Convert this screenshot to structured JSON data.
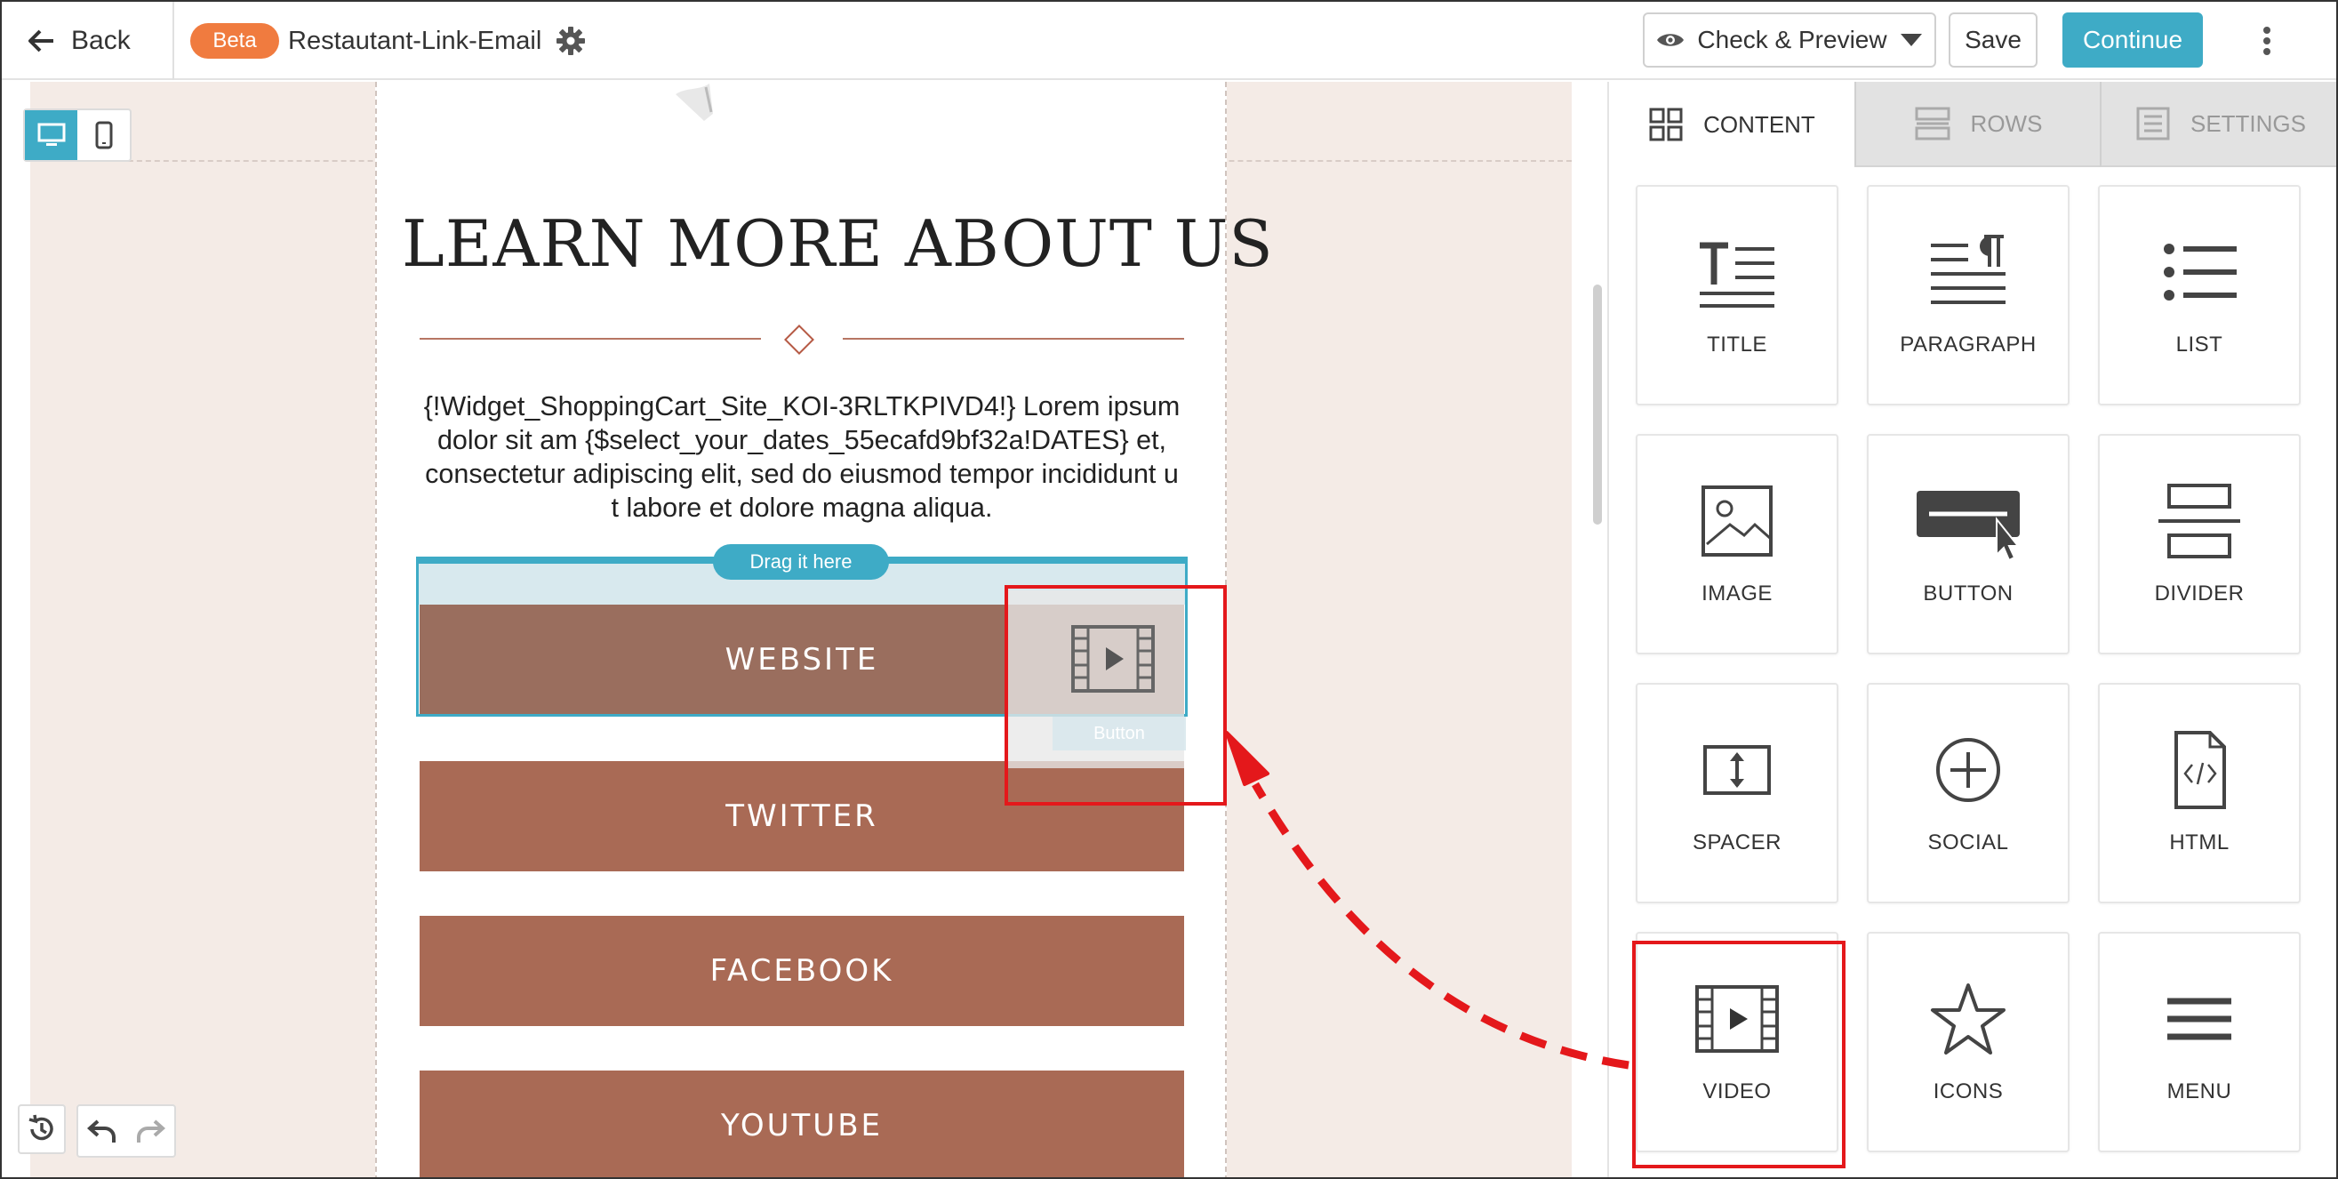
{
  "topbar": {
    "back_label": "Back",
    "beta_badge": "Beta",
    "document_title": "Restautant-Link-Email",
    "preview_label": "Check & Preview",
    "save_label": "Save",
    "continue_label": "Continue"
  },
  "canvas": {
    "heading": "LEARN MORE ABOUT US",
    "body_text": "{!Widget_ShoppingCart_Site_KOI-3RLTKPIVD4!} Lorem ipsum dolor sit am {$select_your_dates_55ecafd9bf32a!DATES} et, consectetur adipiscing elit, sed do eiusmod tempor incididunt u t labore et dolore magna aliqua.",
    "drag_hint": "Drag it here",
    "drag_card_label": "Button",
    "buttons": [
      "WEBSITE",
      "TWITTER",
      "FACEBOOK",
      "YOUTUBE"
    ]
  },
  "panel": {
    "tabs": [
      {
        "label": "CONTENT",
        "icon": "grid-icon",
        "active": true
      },
      {
        "label": "ROWS",
        "icon": "rows-icon",
        "active": false
      },
      {
        "label": "SETTINGS",
        "icon": "settings-icon",
        "active": false
      }
    ],
    "tiles": [
      {
        "label": "TITLE",
        "icon": "title-icon"
      },
      {
        "label": "PARAGRAPH",
        "icon": "paragraph-icon"
      },
      {
        "label": "LIST",
        "icon": "list-icon"
      },
      {
        "label": "IMAGE",
        "icon": "image-icon"
      },
      {
        "label": "BUTTON",
        "icon": "button-icon"
      },
      {
        "label": "DIVIDER",
        "icon": "divider-icon"
      },
      {
        "label": "SPACER",
        "icon": "spacer-icon"
      },
      {
        "label": "SOCIAL",
        "icon": "social-icon"
      },
      {
        "label": "HTML",
        "icon": "html-icon"
      },
      {
        "label": "VIDEO",
        "icon": "video-icon"
      },
      {
        "label": "ICONS",
        "icon": "star-icon"
      },
      {
        "label": "MENU",
        "icon": "menu-icon"
      }
    ]
  },
  "colors": {
    "accent": "#3eabc6",
    "beta": "#f07b3f",
    "email_button": "#a96a55",
    "canvas_bg": "#f4ebe6",
    "annotation_red": "#e4181b"
  }
}
